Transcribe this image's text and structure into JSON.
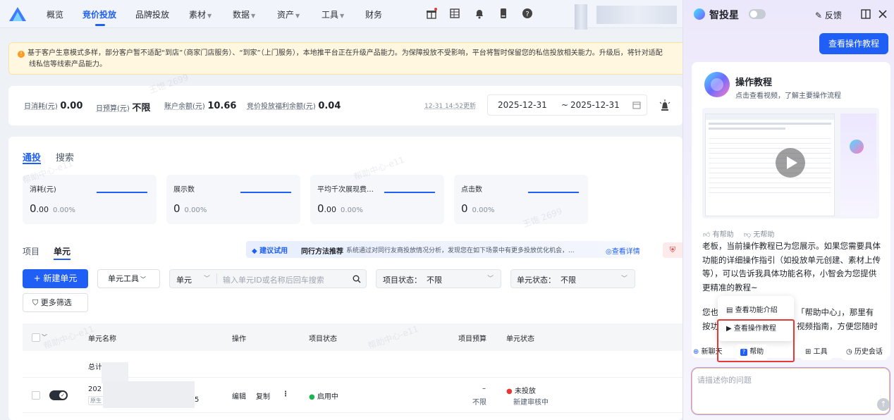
{
  "nav": {
    "items": [
      {
        "label": "概览",
        "caret": false
      },
      {
        "label": "竞价投放",
        "caret": false,
        "active": true
      },
      {
        "label": "品牌投放",
        "caret": false
      },
      {
        "label": "素材",
        "caret": true
      },
      {
        "label": "数据",
        "caret": true
      },
      {
        "label": "资产",
        "caret": true
      },
      {
        "label": "工具",
        "caret": true
      },
      {
        "label": "财务",
        "caret": false
      }
    ],
    "icons": [
      "gift-icon",
      "grid-icon",
      "bell-icon",
      "phone-icon",
      "help-icon"
    ]
  },
  "banner": {
    "text": "基于客户生意模式多样，部分客户暂不适配“到店”（商家门店服务）、“到家”（上门服务），本地推平台正在升级产品能力。为保障投放不受影响，平台将暂时保留您的私信投放相关能力。升级后，将针对适配",
    "text2": "线私信等线索产品能力。"
  },
  "stats": [
    {
      "label": "日消耗(元)",
      "value": "0.00"
    },
    {
      "label": "日预算(元)",
      "value": "不限"
    },
    {
      "label": "账户余额(元)",
      "value": "10.66"
    },
    {
      "label": "竞价投放福利余额(元)",
      "value": "0.04"
    }
  ],
  "update_time": "12-31 14:52更新",
  "date_range": {
    "start": "2025-12-31",
    "sep": "~",
    "end": "2025-12-31"
  },
  "main_tabs": [
    {
      "label": "通投",
      "active": true
    },
    {
      "label": "搜索",
      "active": false
    }
  ],
  "metrics": [
    {
      "title": "消耗(元)",
      "value_int": "0",
      "value_dec": ".00",
      "pct": "0.00%"
    },
    {
      "title": "展示数",
      "value_int": "0",
      "value_dec": "",
      "pct": "0.00%"
    },
    {
      "title": "平均千次展现费…",
      "value_int": "0",
      "value_dec": ".00",
      "pct": "0.00%"
    },
    {
      "title": "点击数",
      "value_int": "0",
      "value_dec": "",
      "pct": "0.00%"
    }
  ],
  "sub_tabs": [
    {
      "label": "项目",
      "active": false
    },
    {
      "label": "单元",
      "active": true
    }
  ],
  "recommend": {
    "tag": "建议试用",
    "title": "同行方法推荐",
    "desc": "系统通过对同行友商投放情况分析，发现您在如下场景中有更多投放优化机会，...",
    "link": "查看详情"
  },
  "toolbar": {
    "new_unit": "+ 新建单元",
    "unit_tools": "单元工具",
    "search_type": "单元",
    "search_placeholder": "输入单元ID或名称后回车搜索",
    "project_status_label": "项目状态：",
    "project_status_value": "不限",
    "unit_status_label": "单元状态：",
    "unit_status_value": "不限",
    "more_filters": "更多筛选"
  },
  "table": {
    "headers": [
      "单元名称",
      "操作",
      "项目状态",
      "项目预算",
      "单元状态"
    ],
    "total_label": "总计",
    "rows": [
      {
        "name": "202",
        "tag": "原生",
        "suffix": "5",
        "actions": [
          "编辑",
          "复制",
          "⋮"
        ],
        "project_status": "启用中",
        "budget_top": "–",
        "budget_bottom": "不限",
        "unit_status": "未投放",
        "unit_status_sub": "新建审核中"
      }
    ]
  },
  "assistant": {
    "title": "智投星",
    "feedback": "反馈",
    "tutorial_button": "查看操作教程",
    "card_title": "操作教程",
    "card_subtitle": "点击查看视频，了解主要操作流程",
    "helpful": "有帮助",
    "not_helpful": "无帮助",
    "message": "老板，当前操作教程已为您展示。如果您需要具体功能的详细操作指引（如投放单元创建、素材上传等），可以告诉我具体功能名称，小智会为您提供更精准的教程~",
    "message2_a": "您也",
    "message2_b": "「帮助中心」，那里有",
    "message3_a": "按功",
    "message3_b": "视频指南，方便您随时",
    "popup_items": [
      "查看功能介绍",
      "查看操作教程"
    ],
    "bottom_chips": [
      "新聊天",
      "帮助",
      "工具",
      "历史会话"
    ],
    "input_placeholder": "请描述你的问题"
  },
  "watermark_text": "帮助中心-e11",
  "watermark_text2": "王饱 2699",
  "colors": {
    "primary": "#1f5ff5",
    "warning": "#ff9a1f",
    "danger": "#e53935",
    "success": "#1eb254"
  }
}
